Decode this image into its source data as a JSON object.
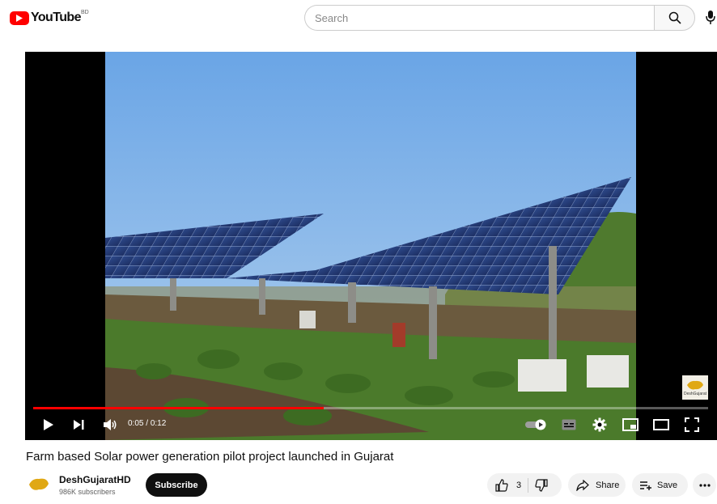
{
  "header": {
    "logo_text": "YouTube",
    "country_code": "BD",
    "search_placeholder": "Search"
  },
  "player": {
    "time_current": "0:05",
    "time_separator": " / ",
    "time_total": "0:12",
    "progress_fraction": 0.43,
    "watermark_text": "DeshGujarat",
    "colors": {
      "progress": "#ff0000",
      "background": "#000000"
    }
  },
  "video": {
    "title": "Farm based Solar power generation pilot project launched in Gujarat"
  },
  "channel": {
    "name": "DeshGujaratHD",
    "subscribers": "986K subscribers",
    "subscribe_label": "Subscribe",
    "avatar_text": "DeshGujarat"
  },
  "actions": {
    "like_count": "3",
    "share_label": "Share",
    "save_label": "Save"
  }
}
